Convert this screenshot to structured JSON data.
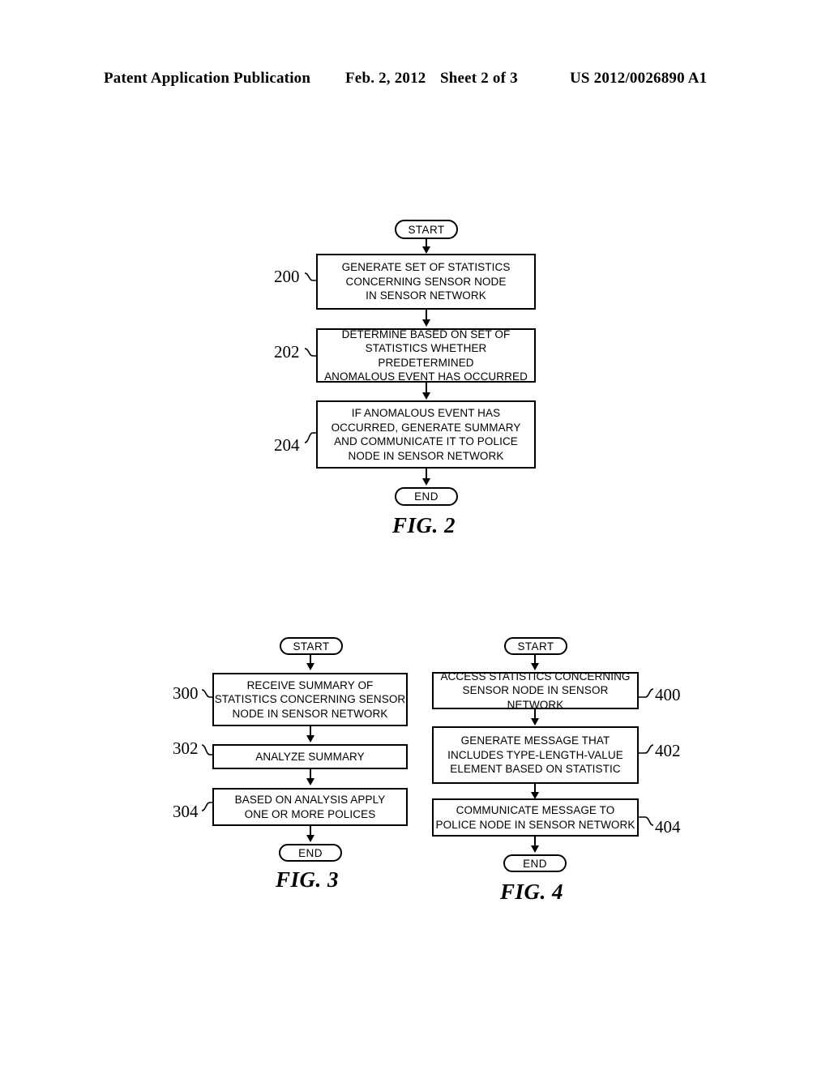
{
  "header": {
    "publication": "Patent Application Publication",
    "date": "Feb. 2, 2012",
    "sheet": "Sheet 2 of 3",
    "patent_number": "US 2012/0026890 A1"
  },
  "terminators": {
    "start": "START",
    "end": "END"
  },
  "figures": [
    {
      "id": "fig2",
      "caption": "FIG. 2",
      "steps": [
        {
          "ref": "200",
          "text": "GENERATE SET OF STATISTICS\nCONCERNING SENSOR NODE\nIN SENSOR NETWORK"
        },
        {
          "ref": "202",
          "text": "DETERMINE BASED ON SET OF\nSTATISTICS WHETHER PREDETERMINED\nANOMALOUS EVENT HAS OCCURRED"
        },
        {
          "ref": "204",
          "text": "IF ANOMALOUS EVENT HAS\nOCCURRED, GENERATE SUMMARY\nAND COMMUNICATE IT TO POLICE\nNODE IN SENSOR NETWORK"
        }
      ]
    },
    {
      "id": "fig3",
      "caption": "FIG. 3",
      "steps": [
        {
          "ref": "300",
          "text": "RECEIVE SUMMARY OF\nSTATISTICS CONCERNING SENSOR\nNODE IN SENSOR NETWORK"
        },
        {
          "ref": "302",
          "text": "ANALYZE SUMMARY"
        },
        {
          "ref": "304",
          "text": "BASED ON ANALYSIS APPLY\nONE OR MORE POLICES"
        }
      ]
    },
    {
      "id": "fig4",
      "caption": "FIG. 4",
      "steps": [
        {
          "ref": "400",
          "text": "ACCESS STATISTICS CONCERNING\nSENSOR NODE IN SENSOR NETWORK"
        },
        {
          "ref": "402",
          "text": "GENERATE MESSAGE THAT\nINCLUDES TYPE-LENGTH-VALUE\nELEMENT BASED ON STATISTIC"
        },
        {
          "ref": "404",
          "text": "COMMUNICATE MESSAGE TO\nPOLICE NODE IN SENSOR NETWORK"
        }
      ]
    }
  ]
}
